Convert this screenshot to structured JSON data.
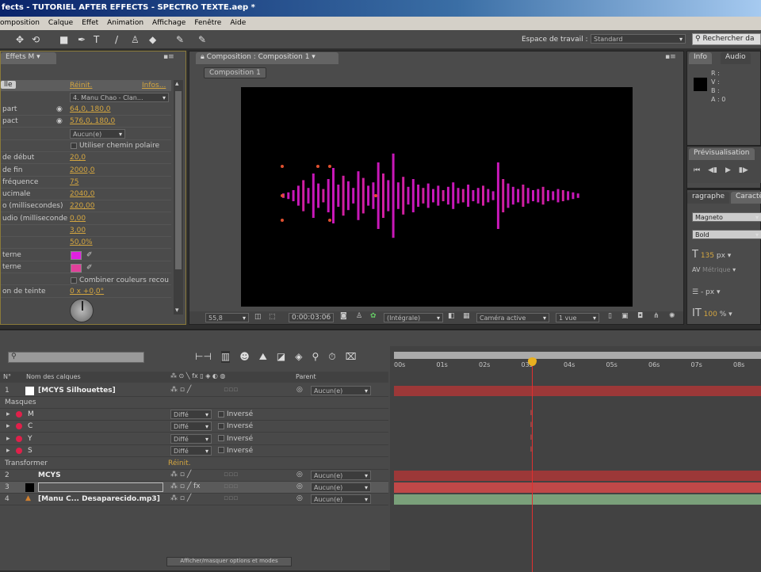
{
  "window": {
    "title": "fects - TUTORIEL AFTER EFFECTS - SPECTRO TEXTE.aep *"
  },
  "menu": [
    "omposition",
    "Calque",
    "Effet",
    "Animation",
    "Affichage",
    "Fenêtre",
    "Aide"
  ],
  "toolbar": {
    "workspace_label": "Espace de travail :",
    "workspace_value": "Standard",
    "search_placeholder": "Rechercher da"
  },
  "effects": {
    "tab": "Effets M",
    "header_reset": "Réinit.",
    "header_about": "Infos...",
    "audio_layer": "4. Manu Chao - Clan...",
    "rows": [
      {
        "label": "part",
        "value": "64,0, 180,0"
      },
      {
        "label": "pact",
        "value": "576,0, 180,0"
      },
      {
        "label": "",
        "value": ""
      },
      {
        "label": "",
        "value": ""
      },
      {
        "label": "de début",
        "value": "20,0"
      },
      {
        "label": "de fin",
        "value": "2000,0"
      },
      {
        "label": "fréquence",
        "value": "75"
      },
      {
        "label": "ucimale",
        "value": "2040,0"
      },
      {
        "label": "o (millisecondes)",
        "value": "220,00"
      },
      {
        "label": "udio (milliseconde",
        "value": "0,00"
      },
      {
        "label": "",
        "value": "3,00"
      },
      {
        "label": "",
        "value": "50,0%"
      },
      {
        "label": "terne",
        "value": ""
      },
      {
        "label": "terne",
        "value": ""
      },
      {
        "label": "",
        "value": ""
      },
      {
        "label": "on de teinte",
        "value": "0 x +0,0°"
      }
    ],
    "path_dropdown": "Aucun(e)",
    "polar_label": "Utiliser chemin polaire",
    "combine_label": "Combiner couleurs recou",
    "inner_color": "#e020e0",
    "outer_color": "#e0409a"
  },
  "comp": {
    "tab": "Composition : Composition 1",
    "subtab": "Composition 1",
    "zoom": "55,8",
    "timecode": "0:00:03:06",
    "resolution": "(Intégrale)",
    "camera": "Caméra active",
    "views": "1 vue"
  },
  "info": {
    "tab1": "Info",
    "tab2": "Audio",
    "r": "R :",
    "g": "V :",
    "b": "B :",
    "a": "A : 0"
  },
  "preview": {
    "tab": "Prévisualisation"
  },
  "character": {
    "tab1": "ragraphe",
    "tab2": "Caractè",
    "font": "Magneto",
    "style": "Bold",
    "size": "135",
    "size_unit": "px",
    "kerning": "Métrique",
    "leading_unit": "- px",
    "scale": "100",
    "scale_unit": "%"
  },
  "timeline": {
    "search_placeholder": "",
    "col_num": "N°",
    "col_name": "Nom des calques",
    "col_parent": "Parent",
    "ruler": [
      "00s",
      "01s",
      "02s",
      "03s",
      "04s",
      "05s",
      "06s",
      "07s",
      "08s"
    ],
    "playhead_fraction": 0.375,
    "layers": [
      {
        "num": "1",
        "name": "[MCYS Silhouettes]",
        "parent": "Aucun(e)",
        "color": "#ffffff",
        "track": "#9c3838"
      },
      {
        "num": "2",
        "name": "MCYS",
        "parent": "Aucun(e)",
        "color": "",
        "track": "#9c3838"
      },
      {
        "num": "3",
        "name": "",
        "parent": "Aucun(e)",
        "color": "#000000",
        "track": "#c04848"
      },
      {
        "num": "4",
        "name": "[Manu C... Desaparecido.mp3]",
        "parent": "Aucun(e)",
        "color": "#d08030",
        "track": "#7aa07a"
      }
    ],
    "masks_label": "Masques",
    "masks": [
      {
        "name": "M",
        "mode": "Diffé",
        "inv": "Inversé"
      },
      {
        "name": "C",
        "mode": "Diffé",
        "inv": "Inversé"
      },
      {
        "name": "Y",
        "mode": "Diffé",
        "inv": "Inversé"
      },
      {
        "name": "S",
        "mode": "Diffé",
        "inv": "Inversé"
      }
    ],
    "transform_label": "Transformer",
    "transform_reset": "Réinit.",
    "footer": "Afficher/masquer options et modes"
  }
}
